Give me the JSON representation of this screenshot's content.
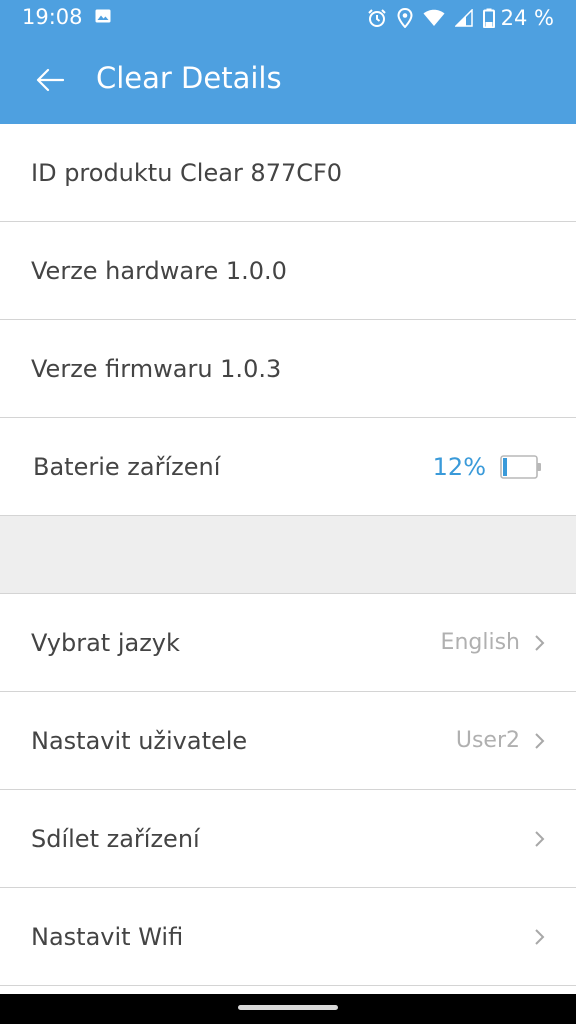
{
  "status_bar": {
    "time": "19:08",
    "battery": "24 %",
    "icons": [
      "image-icon",
      "alarm-icon",
      "location-icon",
      "wifi-icon",
      "signal-icon",
      "battery-icon"
    ]
  },
  "app_bar": {
    "title": "Clear Details",
    "color": "#4ea0e0"
  },
  "info": {
    "product_id": "ID produktu Clear 877CF0",
    "hardware": "Verze hardware 1.0.0",
    "firmware": "Verze firmwaru 1.0.3",
    "battery_label": "Baterie zařízení",
    "battery_value": "12%",
    "battery_level": 0.12
  },
  "settings": {
    "language_label": "Vybrat jazyk",
    "language_value": "English",
    "user_label": "Nastavit uživatele",
    "user_value": "User2",
    "share_label": "Sdílet zařízení",
    "wifi_label": "Nastavit Wifi"
  }
}
